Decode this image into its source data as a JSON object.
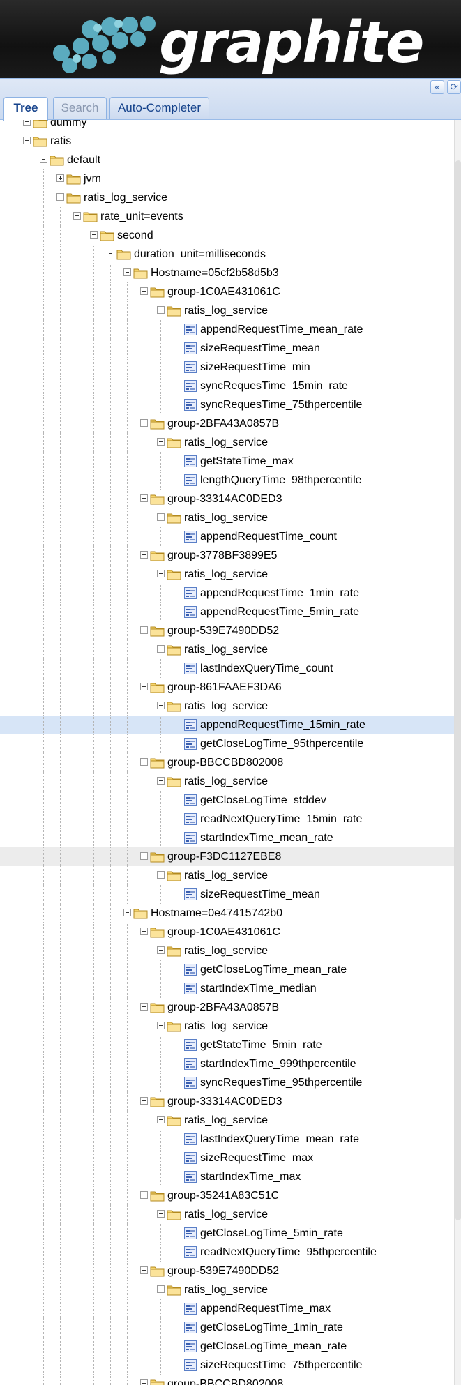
{
  "header": {
    "logo_text": "graphite"
  },
  "tabs": [
    {
      "label": "Tree",
      "active": true
    },
    {
      "label": "Search",
      "active": false
    },
    {
      "label": "Auto-Completer",
      "active": false
    }
  ],
  "toolbar": {
    "collapse_icon": "double-chevron-left-icon",
    "refresh_icon": "refresh-icon"
  },
  "colors": {
    "selected_row": "#d7e5f7",
    "hover_row": "#ececec",
    "tab_text": "#15428b"
  },
  "tree": [
    {
      "d": 1,
      "t": "f",
      "open": false,
      "label": "dummy"
    },
    {
      "d": 1,
      "t": "f",
      "open": true,
      "label": "ratis"
    },
    {
      "d": 2,
      "t": "f",
      "open": true,
      "label": "default"
    },
    {
      "d": 3,
      "t": "f",
      "open": false,
      "label": "jvm"
    },
    {
      "d": 3,
      "t": "f",
      "open": true,
      "label": "ratis_log_service"
    },
    {
      "d": 4,
      "t": "f",
      "open": true,
      "label": "rate_unit=events"
    },
    {
      "d": 5,
      "t": "f",
      "open": true,
      "label": "second"
    },
    {
      "d": 6,
      "t": "f",
      "open": true,
      "label": "duration_unit=milliseconds"
    },
    {
      "d": 7,
      "t": "f",
      "open": true,
      "label": "Hostname=05cf2b58d5b3"
    },
    {
      "d": 8,
      "t": "f",
      "open": true,
      "label": "group-1C0AE431061C"
    },
    {
      "d": 9,
      "t": "f",
      "open": true,
      "label": "ratis_log_service"
    },
    {
      "d": 10,
      "t": "l",
      "label": "appendRequestTime_mean_rate"
    },
    {
      "d": 10,
      "t": "l",
      "label": "sizeRequestTime_mean"
    },
    {
      "d": 10,
      "t": "l",
      "label": "sizeRequestTime_min"
    },
    {
      "d": 10,
      "t": "l",
      "label": "syncRequesTime_15min_rate"
    },
    {
      "d": 10,
      "t": "l",
      "label": "syncRequesTime_75thpercentile"
    },
    {
      "d": 8,
      "t": "f",
      "open": true,
      "label": "group-2BFA43A0857B"
    },
    {
      "d": 9,
      "t": "f",
      "open": true,
      "label": "ratis_log_service"
    },
    {
      "d": 10,
      "t": "l",
      "label": "getStateTime_max"
    },
    {
      "d": 10,
      "t": "l",
      "label": "lengthQueryTime_98thpercentile"
    },
    {
      "d": 8,
      "t": "f",
      "open": true,
      "label": "group-33314AC0DED3"
    },
    {
      "d": 9,
      "t": "f",
      "open": true,
      "label": "ratis_log_service"
    },
    {
      "d": 10,
      "t": "l",
      "label": "appendRequestTime_count"
    },
    {
      "d": 8,
      "t": "f",
      "open": true,
      "label": "group-3778BF3899E5"
    },
    {
      "d": 9,
      "t": "f",
      "open": true,
      "label": "ratis_log_service"
    },
    {
      "d": 10,
      "t": "l",
      "label": "appendRequestTime_1min_rate"
    },
    {
      "d": 10,
      "t": "l",
      "label": "appendRequestTime_5min_rate"
    },
    {
      "d": 8,
      "t": "f",
      "open": true,
      "label": "group-539E7490DD52"
    },
    {
      "d": 9,
      "t": "f",
      "open": true,
      "label": "ratis_log_service"
    },
    {
      "d": 10,
      "t": "l",
      "label": "lastIndexQueryTime_count"
    },
    {
      "d": 8,
      "t": "f",
      "open": true,
      "label": "group-861FAAEF3DA6"
    },
    {
      "d": 9,
      "t": "f",
      "open": true,
      "label": "ratis_log_service"
    },
    {
      "d": 10,
      "t": "l",
      "label": "appendRequestTime_15min_rate",
      "selected": true
    },
    {
      "d": 10,
      "t": "l",
      "label": "getCloseLogTime_95thpercentile"
    },
    {
      "d": 8,
      "t": "f",
      "open": true,
      "label": "group-BBCCBD802008"
    },
    {
      "d": 9,
      "t": "f",
      "open": true,
      "label": "ratis_log_service"
    },
    {
      "d": 10,
      "t": "l",
      "label": "getCloseLogTime_stddev"
    },
    {
      "d": 10,
      "t": "l",
      "label": "readNextQueryTime_15min_rate"
    },
    {
      "d": 10,
      "t": "l",
      "label": "startIndexTime_mean_rate"
    },
    {
      "d": 8,
      "t": "f",
      "open": true,
      "label": "group-F3DC1127EBE8",
      "hover": true
    },
    {
      "d": 9,
      "t": "f",
      "open": true,
      "label": "ratis_log_service"
    },
    {
      "d": 10,
      "t": "l",
      "label": "sizeRequestTime_mean"
    },
    {
      "d": 7,
      "t": "f",
      "open": true,
      "label": "Hostname=0e47415742b0"
    },
    {
      "d": 8,
      "t": "f",
      "open": true,
      "label": "group-1C0AE431061C"
    },
    {
      "d": 9,
      "t": "f",
      "open": true,
      "label": "ratis_log_service"
    },
    {
      "d": 10,
      "t": "l",
      "label": "getCloseLogTime_mean_rate"
    },
    {
      "d": 10,
      "t": "l",
      "label": "startIndexTime_median"
    },
    {
      "d": 8,
      "t": "f",
      "open": true,
      "label": "group-2BFA43A0857B"
    },
    {
      "d": 9,
      "t": "f",
      "open": true,
      "label": "ratis_log_service"
    },
    {
      "d": 10,
      "t": "l",
      "label": "getStateTime_5min_rate"
    },
    {
      "d": 10,
      "t": "l",
      "label": "startIndexTime_999thpercentile"
    },
    {
      "d": 10,
      "t": "l",
      "label": "syncRequesTime_95thpercentile"
    },
    {
      "d": 8,
      "t": "f",
      "open": true,
      "label": "group-33314AC0DED3"
    },
    {
      "d": 9,
      "t": "f",
      "open": true,
      "label": "ratis_log_service"
    },
    {
      "d": 10,
      "t": "l",
      "label": "lastIndexQueryTime_mean_rate"
    },
    {
      "d": 10,
      "t": "l",
      "label": "sizeRequestTime_max"
    },
    {
      "d": 10,
      "t": "l",
      "label": "startIndexTime_max"
    },
    {
      "d": 8,
      "t": "f",
      "open": true,
      "label": "group-35241A83C51C"
    },
    {
      "d": 9,
      "t": "f",
      "open": true,
      "label": "ratis_log_service"
    },
    {
      "d": 10,
      "t": "l",
      "label": "getCloseLogTime_5min_rate"
    },
    {
      "d": 10,
      "t": "l",
      "label": "readNextQueryTime_95thpercentile"
    },
    {
      "d": 8,
      "t": "f",
      "open": true,
      "label": "group-539E7490DD52"
    },
    {
      "d": 9,
      "t": "f",
      "open": true,
      "label": "ratis_log_service"
    },
    {
      "d": 10,
      "t": "l",
      "label": "appendRequestTime_max"
    },
    {
      "d": 10,
      "t": "l",
      "label": "getCloseLogTime_1min_rate"
    },
    {
      "d": 10,
      "t": "l",
      "label": "getCloseLogTime_mean_rate"
    },
    {
      "d": 10,
      "t": "l",
      "label": "sizeRequestTime_75thpercentile"
    },
    {
      "d": 8,
      "t": "f",
      "open": true,
      "label": "group-BBCCBD802008"
    }
  ]
}
